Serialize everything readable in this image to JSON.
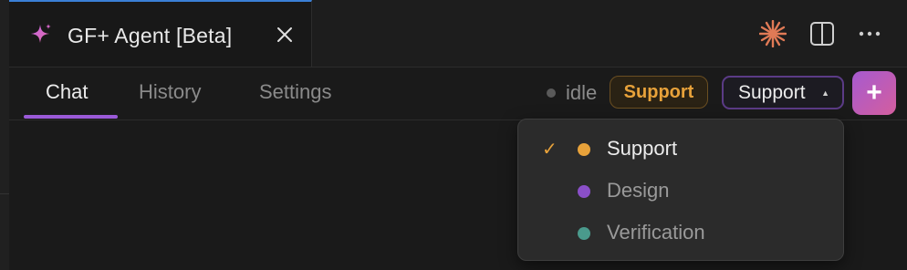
{
  "tab": {
    "title": "GF+ Agent [Beta]",
    "icon": "sparkle-icon",
    "accent_color": "#3a7fd6"
  },
  "toolbar_icons": [
    "claude-icon",
    "split-panel-icon",
    "more-icon"
  ],
  "nav": {
    "tabs": [
      {
        "label": "Chat",
        "active": true
      },
      {
        "label": "History",
        "active": false
      },
      {
        "label": "Settings",
        "active": false
      }
    ]
  },
  "status": {
    "text": "idle",
    "badge": "Support",
    "badge_color": "#e8a23a"
  },
  "agent_select": {
    "value": "Support",
    "caret": "▲"
  },
  "add_button": {
    "label": "+",
    "gradient": [
      "#a65ad0",
      "#d45e9e"
    ]
  },
  "dropdown": {
    "items": [
      {
        "label": "Support",
        "color": "#e8a23a",
        "selected": true,
        "check": "✓"
      },
      {
        "label": "Design",
        "color": "#8a4fc8",
        "selected": false,
        "check": ""
      },
      {
        "label": "Verification",
        "color": "#4a9a8c",
        "selected": false,
        "check": ""
      }
    ]
  }
}
